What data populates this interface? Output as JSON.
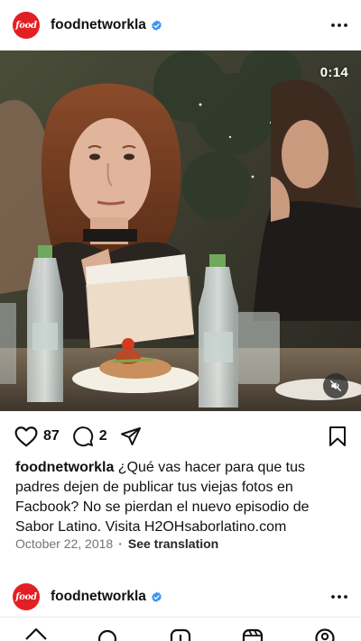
{
  "post": {
    "account": {
      "username": "foodnetworkla",
      "avatar_text": "food",
      "avatar_color": "#e22024",
      "verified": true,
      "verified_color": "#3897f0"
    },
    "media": {
      "type": "video",
      "timestamp": "0:14",
      "muted": true
    },
    "actions": {
      "likes": "87",
      "comments": "2"
    },
    "caption": {
      "username": "foodnetworkla",
      "text": "¿Qué vas hacer para que tus padres dejen de publicar tus viejas fotos en Facbook? No se pierdan el nuevo episodio de Sabor Latino. Visita H2OHsaborlatino.com"
    },
    "date": "October 22, 2018",
    "see_translation": "See translation"
  },
  "next_post": {
    "account": {
      "username": "foodnetworkla",
      "avatar_text": "food",
      "verified": true
    }
  },
  "icons": {
    "like": "heart-icon",
    "comment": "comment-icon",
    "share": "send-icon",
    "save": "bookmark-icon",
    "more": "more-icon",
    "mute": "mute-icon",
    "nav": [
      "home-icon",
      "search-icon",
      "create-icon",
      "reels-icon",
      "profile-icon"
    ]
  }
}
